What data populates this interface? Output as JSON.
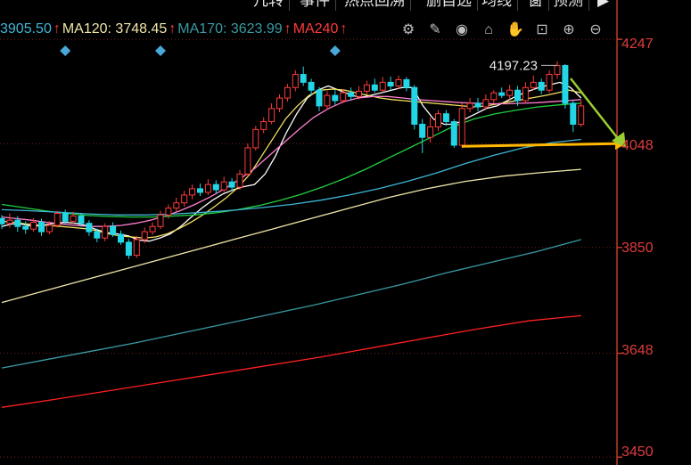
{
  "toolbar": {
    "tabs": [
      {
        "label": "几转"
      },
      {
        "label": "事件"
      },
      {
        "label": "热点回溯"
      },
      {
        "label": "删自选"
      },
      {
        "label": "均线"
      },
      {
        "label": "窗"
      },
      {
        "label": "预测"
      }
    ],
    "icons": [
      "gear-icon",
      "brush-icon",
      "eye-icon",
      "basket-icon",
      "hand-icon",
      "lock-icon",
      "zoom-in-icon",
      "zoom-out-icon"
    ]
  },
  "ma_legend": [
    {
      "text": "3905.50",
      "color": "#3fb5d6"
    },
    {
      "text": "MA120: 3748.45",
      "color": "#f0e6a8"
    },
    {
      "text": "MA170: 3623.99",
      "color": "#3a9aa3"
    },
    {
      "text": "MA240",
      "color": "#ff3b3b"
    }
  ],
  "colors": {
    "up": "#ff3b3b",
    "down": "#22d6e6",
    "axis": "#c0392b",
    "marker": "#4aa8d8",
    "arrow_green": "#9acd32",
    "arrow_yellow": "#ffb800"
  },
  "chart_data": {
    "type": "candlestick",
    "y_axis": {
      "ticks": [
        4247,
        4048,
        3850,
        3648,
        3450
      ],
      "ylim": [
        3435,
        4288
      ]
    },
    "annotation": {
      "label": "4197.23",
      "value": 4197.23
    },
    "reference_level": 4048,
    "candles": [
      [
        3905,
        3895,
        3912,
        3885
      ],
      [
        3896,
        3902,
        3915,
        3888
      ],
      [
        3902,
        3890,
        3910,
        3880
      ],
      [
        3890,
        3885,
        3900,
        3876
      ],
      [
        3885,
        3898,
        3906,
        3880
      ],
      [
        3898,
        3880,
        3905,
        3872
      ],
      [
        3880,
        3892,
        3900,
        3875
      ],
      [
        3892,
        3915,
        3920,
        3888
      ],
      [
        3915,
        3900,
        3922,
        3895
      ],
      [
        3900,
        3910,
        3918,
        3896
      ],
      [
        3910,
        3896,
        3915,
        3890
      ],
      [
        3896,
        3880,
        3902,
        3872
      ],
      [
        3880,
        3868,
        3886,
        3860
      ],
      [
        3868,
        3890,
        3896,
        3862
      ],
      [
        3890,
        3875,
        3898,
        3870
      ],
      [
        3875,
        3860,
        3882,
        3855
      ],
      [
        3860,
        3835,
        3866,
        3828
      ],
      [
        3835,
        3865,
        3872,
        3830
      ],
      [
        3865,
        3880,
        3888,
        3858
      ],
      [
        3880,
        3890,
        3898,
        3874
      ],
      [
        3890,
        3912,
        3920,
        3885
      ],
      [
        3912,
        3925,
        3932,
        3905
      ],
      [
        3925,
        3935,
        3945,
        3918
      ],
      [
        3935,
        3950,
        3958,
        3928
      ],
      [
        3950,
        3962,
        3970,
        3942
      ],
      [
        3962,
        3955,
        3972,
        3948
      ],
      [
        3955,
        3970,
        3980,
        3950
      ],
      [
        3970,
        3960,
        3978,
        3952
      ],
      [
        3960,
        3975,
        3985,
        3955
      ],
      [
        3975,
        3965,
        3982,
        3958
      ],
      [
        3965,
        3990,
        3998,
        3960
      ],
      [
        3990,
        4040,
        4048,
        3985
      ],
      [
        4040,
        4075,
        4082,
        4035
      ],
      [
        4075,
        4090,
        4098,
        4068
      ],
      [
        4090,
        4115,
        4125,
        4085
      ],
      [
        4115,
        4135,
        4142,
        4108
      ],
      [
        4135,
        4155,
        4162,
        4128
      ],
      [
        4155,
        4180,
        4188,
        4148
      ],
      [
        4180,
        4165,
        4195,
        4158
      ],
      [
        4165,
        4150,
        4172,
        4140
      ],
      [
        4150,
        4120,
        4156,
        4110
      ],
      [
        4120,
        4140,
        4148,
        4112
      ],
      [
        4140,
        4130,
        4150,
        4122
      ],
      [
        4130,
        4145,
        4152,
        4125
      ],
      [
        4145,
        4138,
        4155,
        4130
      ],
      [
        4138,
        4148,
        4158,
        4132
      ],
      [
        4148,
        4160,
        4168,
        4142
      ],
      [
        4160,
        4150,
        4172,
        4145
      ],
      [
        4150,
        4165,
        4175,
        4146
      ],
      [
        4165,
        4158,
        4176,
        4150
      ],
      [
        4158,
        4170,
        4178,
        4152
      ],
      [
        4170,
        4155,
        4175,
        4148
      ],
      [
        4155,
        4085,
        4160,
        4075
      ],
      [
        4085,
        4060,
        4095,
        4030
      ],
      [
        4060,
        4080,
        4098,
        4050
      ],
      [
        4080,
        4105,
        4112,
        4072
      ],
      [
        4105,
        4090,
        4112,
        4082
      ],
      [
        4090,
        4045,
        4095,
        4040
      ],
      [
        4045,
        4115,
        4125,
        4040
      ],
      [
        4115,
        4125,
        4135,
        4108
      ],
      [
        4125,
        4118,
        4135,
        4110
      ],
      [
        4118,
        4132,
        4142,
        4112
      ],
      [
        4132,
        4145,
        4150,
        4125
      ],
      [
        4145,
        4140,
        4155,
        4135
      ],
      [
        4140,
        4150,
        4160,
        4132
      ],
      [
        4150,
        4130,
        4158,
        4120
      ],
      [
        4130,
        4155,
        4165,
        4125
      ],
      [
        4155,
        4165,
        4178,
        4150
      ],
      [
        4165,
        4150,
        4172,
        4142
      ],
      [
        4150,
        4180,
        4188,
        4145
      ],
      [
        4180,
        4197,
        4205,
        4172
      ],
      [
        4197,
        4125,
        4200,
        4115
      ],
      [
        4125,
        4085,
        4130,
        4070
      ],
      [
        4085,
        4120,
        4130,
        4080
      ]
    ],
    "ma_lines": [
      {
        "name": "ma5",
        "color": "#ffffff",
        "values": [
          3890,
          3895,
          3894,
          3890,
          3893,
          3896,
          3898,
          3896,
          3892,
          3884,
          3878,
          3876,
          3872,
          3864,
          3862,
          3868,
          3876,
          3890,
          3908,
          3925,
          3940,
          3952,
          3960,
          3966,
          3970,
          3990,
          4025,
          4068,
          4105,
          4135,
          4150,
          4158,
          4150,
          4142,
          4136,
          4140,
          4145,
          4150,
          4155,
          4155,
          4120,
          4095,
          4085,
          4085,
          4095,
          4105,
          4115,
          4120,
          4130,
          4140,
          4148,
          4155,
          4160,
          4165,
          4155,
          4135
        ]
      },
      {
        "name": "ma10",
        "color": "#f0e060",
        "values": [
          3900,
          3898,
          3895,
          3893,
          3892,
          3890,
          3888,
          3886,
          3882,
          3876,
          3872,
          3870,
          3868,
          3870,
          3876,
          3886,
          3898,
          3912,
          3928,
          3945,
          3965,
          3990,
          4025,
          4060,
          4095,
          4120,
          4140,
          4150,
          4152,
          4150,
          4145,
          4140,
          4135,
          4132,
          4130,
          4128,
          4126,
          4124,
          4122,
          4120,
          4118,
          4120,
          4124,
          4128,
          4132,
          4136,
          4140,
          4145,
          4150,
          4145
        ]
      },
      {
        "name": "ma20",
        "color": "#ff7fd0",
        "values": [
          3908,
          3905,
          3902,
          3898,
          3895,
          3892,
          3890,
          3890,
          3892,
          3896,
          3902,
          3910,
          3920,
          3932,
          3946,
          3962,
          3980,
          4000,
          4025,
          4050,
          4075,
          4098,
          4115,
          4128,
          4135,
          4138,
          4138,
          4135,
          4132,
          4130,
          4128,
          4126,
          4125,
          4124,
          4124,
          4125,
          4126,
          4128,
          4130,
          4132
        ]
      },
      {
        "name": "ma60",
        "color": "#20d040",
        "values": [
          3932,
          3926,
          3920,
          3915,
          3911,
          3909,
          3908,
          3908,
          3910,
          3912,
          3916,
          3922,
          3930,
          3940,
          3952,
          3966,
          3982,
          4000,
          4020,
          4040,
          4060,
          4080,
          4095,
          4105,
          4112,
          4118,
          4122,
          4125
        ]
      },
      {
        "name": "ma90",
        "color": "#3fb5d6",
        "values": [
          3922,
          3920,
          3917,
          3914,
          3912,
          3912,
          3914,
          3917,
          3921,
          3926,
          3932,
          3940,
          3950,
          3962,
          3976,
          3992,
          4010,
          4026,
          4040,
          4050,
          4056
        ]
      },
      {
        "name": "ma120",
        "color": "#f0e6a8",
        "values": [
          3745,
          3765,
          3785,
          3805,
          3825,
          3845,
          3865,
          3885,
          3905,
          3925,
          3945,
          3962,
          3976,
          3986,
          3993,
          3999
        ]
      },
      {
        "name": "ma170",
        "color": "#3a9aa3",
        "values": [
          3620,
          3636,
          3652,
          3668,
          3686,
          3704,
          3722,
          3740,
          3760,
          3780,
          3802,
          3822,
          3842,
          3865
        ]
      },
      {
        "name": "ma240",
        "color": "#ff2020",
        "values": [
          3545,
          3560,
          3576,
          3592,
          3608,
          3624,
          3640,
          3658,
          3676,
          3694,
          3710,
          3720
        ]
      }
    ],
    "markers": {
      "indices": [
        8,
        20,
        42
      ]
    }
  }
}
